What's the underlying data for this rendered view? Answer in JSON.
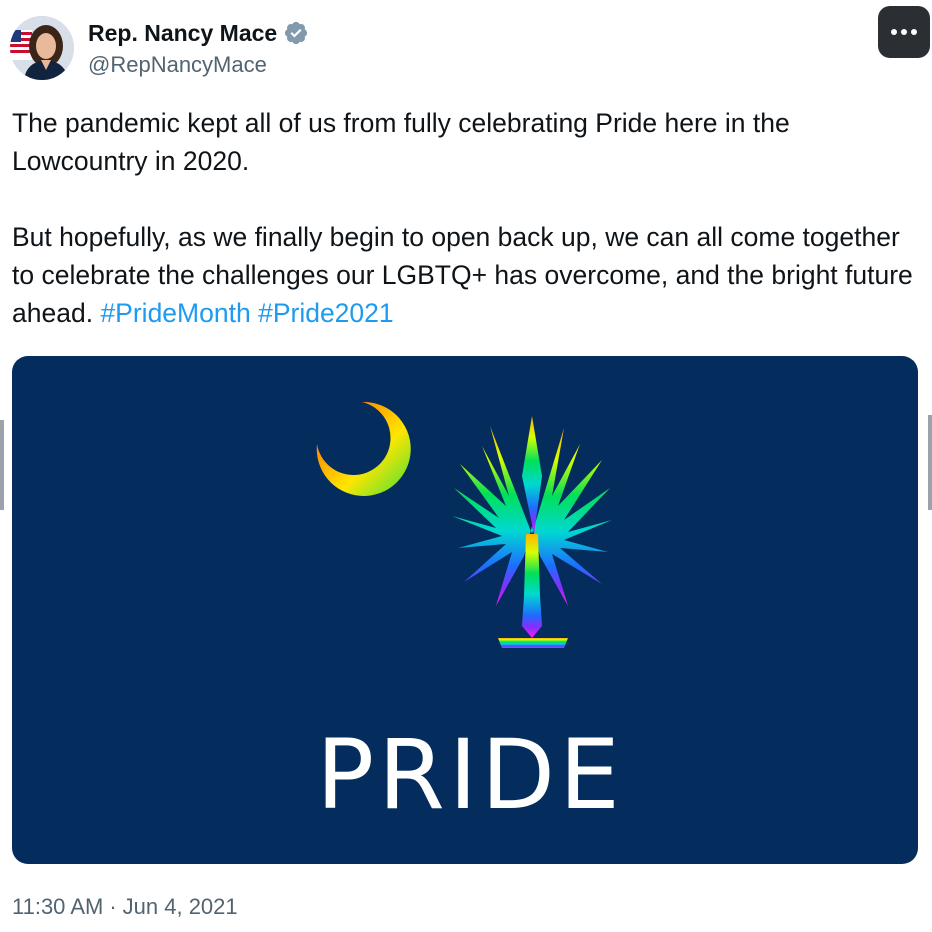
{
  "author": {
    "display_name": "Rep. Nancy Mace",
    "handle": "@RepNancyMace",
    "verified": true,
    "verified_color": "#829aab"
  },
  "menu": {
    "icon": "more-horizontal-icon"
  },
  "tweet": {
    "paragraph_1": "The pandemic kept all of us from fully celebrating Pride here in the Lowcountry in 2020.",
    "paragraph_2_text": "But hopefully, as we finally begin to open back up, we can all come together to celebrate the challenges our LGBTQ+ has overcome, and the bright future ahead.",
    "hashtags": [
      "#PrideMonth",
      "#Pride2021"
    ]
  },
  "media": {
    "background_color": "#042d5e",
    "crescent_icon": "rainbow-crescent-moon-icon",
    "palm_icon": "rainbow-palmetto-tree-icon",
    "caption": "PRIDE"
  },
  "meta": {
    "time": "11:30 AM",
    "separator": "·",
    "date": "Jun 4, 2021"
  },
  "colors": {
    "hashtag": "#1d9bf0",
    "secondary_text": "#536471",
    "primary_text": "#0f1419"
  }
}
